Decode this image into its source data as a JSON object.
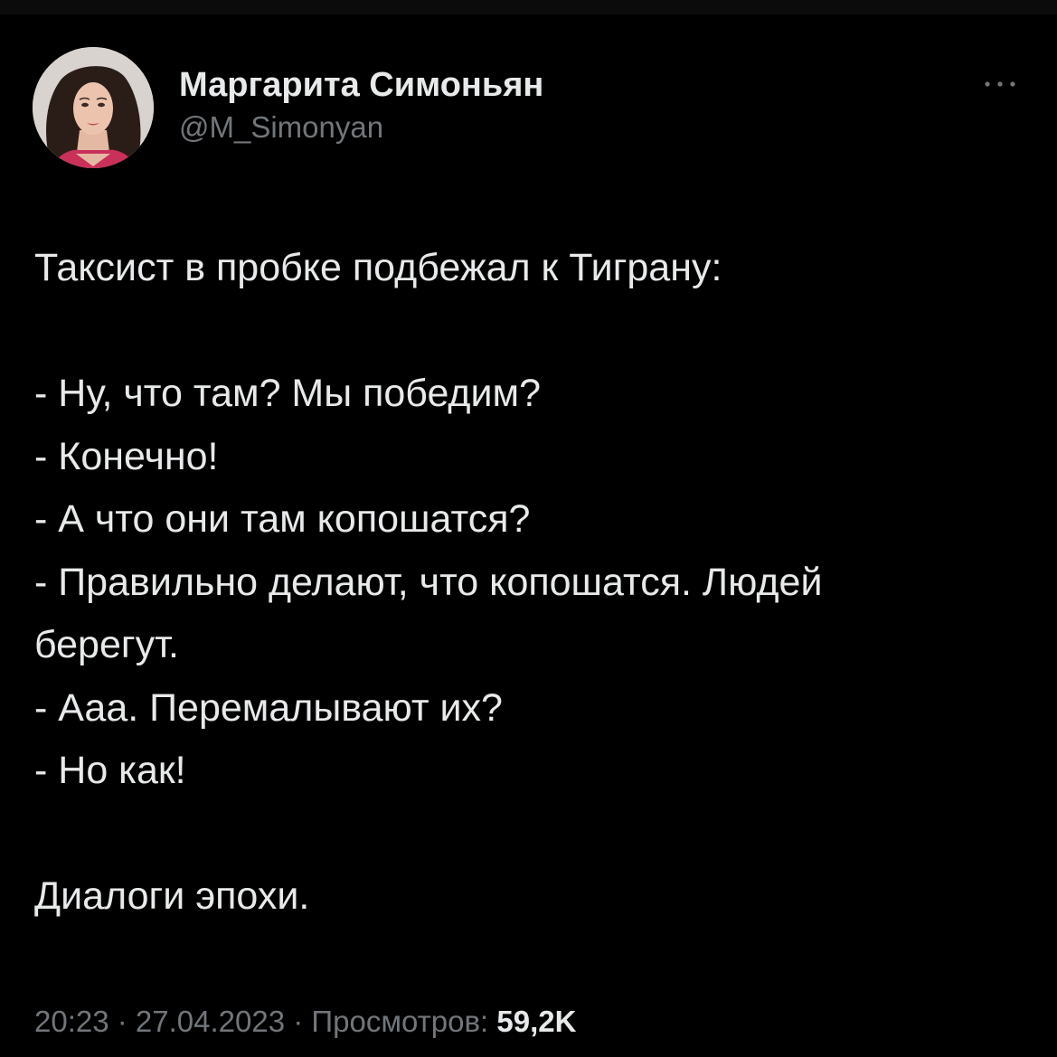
{
  "author": {
    "display_name": "Маргарита Симоньян",
    "handle": "@M_Simonyan",
    "avatar_icon": "user-avatar-photo"
  },
  "more_icon": "more-horizontal-icon",
  "tweet": {
    "lines": [
      "Таксист в пробке подбежал к Тиграну:",
      "",
      "- Ну, что там? Мы победим?",
      "- Конечно!",
      "- А что они там копошатся?",
      "- Правильно делают, что копошатся. Людей",
      "берегут.",
      "- Ааа. Перемалывают их?",
      "- Но как!",
      "",
      "Диалоги эпохи."
    ]
  },
  "meta": {
    "time": "20:23",
    "separator": " · ",
    "date": "27.04.2023",
    "views_label": "Просмотров: ",
    "views_count": "59,2K"
  },
  "colors": {
    "background": "#000000",
    "primary_text": "#e7e9ea",
    "secondary_text": "#71767b"
  }
}
